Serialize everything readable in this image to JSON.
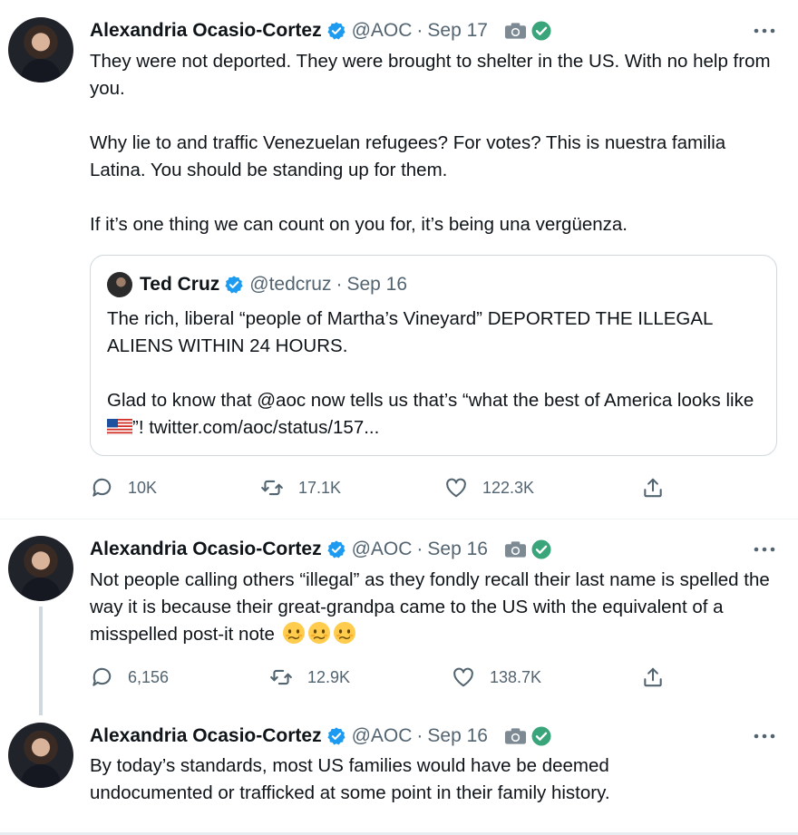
{
  "tweets": [
    {
      "name": "Alexandria Ocasio-Cortez",
      "handle": "@AOC",
      "date": "Sep 17",
      "paragraphs": [
        "They were not deported. They were brought to shelter in the US. With no help from you.",
        "Why lie to and traffic Venezuelan refugees? For votes? This is nuestra familia Latina. You should be standing up for them.",
        "If it’s one thing we can count on you for, it’s being una vergüenza."
      ],
      "quote": {
        "name": "Ted Cruz",
        "handle": "@tedcruz",
        "date": "Sep 16",
        "line1": "The rich, liberal “people of Martha’s Vineyard” DEPORTED THE ILLEGAL ALIENS WITHIN 24 HOURS.",
        "line2_before": "Glad to know that @aoc now tells us that’s “what the best of America looks like ",
        "line2_after": "”! twitter.com/aoc/status/157..."
      },
      "replies": "10K",
      "retweets": "17.1K",
      "likes": "122.3K"
    },
    {
      "name": "Alexandria Ocasio-Cortez",
      "handle": "@AOC",
      "date": "Sep 16",
      "text": "Not people calling others “illegal” as they fondly recall their last name is spelled the way it is because their great-grandpa came to the US with the equivalent of a misspelled post-it note",
      "replies": "6,156",
      "retweets": "12.9K",
      "likes": "138.7K"
    },
    {
      "name": "Alexandria Ocasio-Cortez",
      "handle": "@AOC",
      "date": "Sep 16",
      "text": "By today’s standards, most US families would have be deemed undocumented or trafficked at some point in their family history."
    }
  ],
  "icons": {
    "verified": "verified-badge-icon",
    "camera": "camera-icon",
    "check": "green-check-icon",
    "more": "more-options-icon",
    "reply": "reply-icon",
    "retweet": "retweet-icon",
    "like": "heart-icon",
    "share": "share-icon",
    "emoji": "woozy-face-emoji",
    "flag": "us-flag-emoji"
  },
  "colors": {
    "verified": "#1d9bf0",
    "check": "#3aa57a",
    "secondary_text": "#536471",
    "border": "#cfd9de"
  }
}
